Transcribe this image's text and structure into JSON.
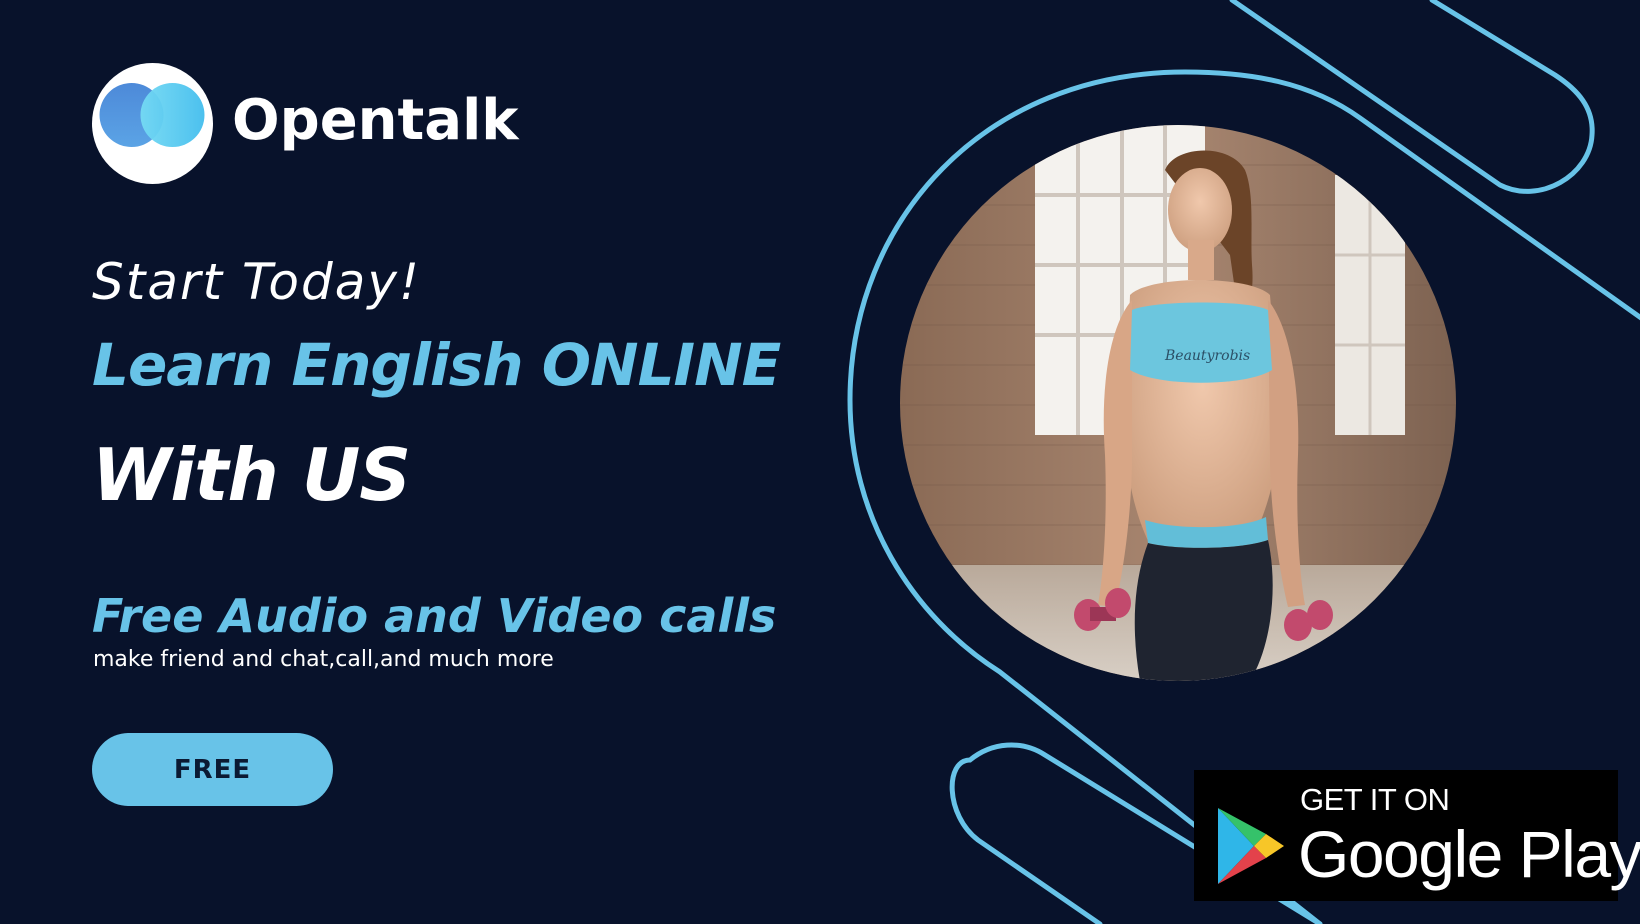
{
  "colors": {
    "background": "#08122b",
    "accent": "#68c3e8",
    "text_light": "#ffffff",
    "button_text": "#0b1a33",
    "badge_background": "#000000"
  },
  "brand": {
    "name": "Opentalk",
    "logo_icon": "heart-logo-icon"
  },
  "hero": {
    "tagline": "Start Today!",
    "headline_line1": "Learn English ONLINE",
    "headline_line2": "With US"
  },
  "feature": {
    "title": "Free Audio and Video calls",
    "subtitle": "make friend and chat,call,and much more"
  },
  "cta": {
    "label": "FREE"
  },
  "store_badge": {
    "line1": "GET IT ON",
    "line2": "Google Play",
    "icon": "google-play-icon"
  },
  "photo": {
    "subject_text": "Beautyrobis"
  }
}
